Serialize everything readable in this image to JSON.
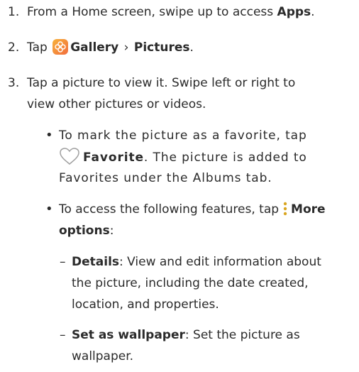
{
  "steps": [
    {
      "number": "1.",
      "text_before": "From a Home screen, swipe up to access ",
      "bold": "Apps",
      "text_after": "."
    },
    {
      "number": "2.",
      "tap": "Tap",
      "gallery_label": "Gallery",
      "separator": "›",
      "pictures_label": "Pictures",
      "end": "."
    },
    {
      "number": "3.",
      "line1": "Tap a picture to view it. Swipe left or right to",
      "line2": "view other pictures or videos."
    }
  ],
  "bullets": {
    "favorite": {
      "marker": "•",
      "line1": "To mark the picture as a favorite, tap",
      "bold": "Favorite",
      "line2_after": ". The picture is added to",
      "line3": "Favorites under the Albums tab."
    },
    "more": {
      "marker": "•",
      "text_before": "To access the following features, tap",
      "bold1": "More",
      "bold2": "options",
      "colon": ":"
    }
  },
  "sub_items": [
    {
      "dash": "–",
      "bold": "Details",
      "line1_after": ": View and edit information about",
      "line2": "the picture, including the date created,",
      "line3": "location, and properties."
    },
    {
      "dash": "–",
      "bold": "Set as wallpaper",
      "line1_after": ": Set the picture as",
      "line2": "wallpaper."
    }
  ],
  "colors": {
    "text": "#2b2b2b",
    "gallery_icon": "#f5913a",
    "heart_outline": "#a0a0a0",
    "more_dots": "#d9a520"
  },
  "icons": [
    "gallery-icon",
    "heart-icon",
    "more-options-icon"
  ]
}
